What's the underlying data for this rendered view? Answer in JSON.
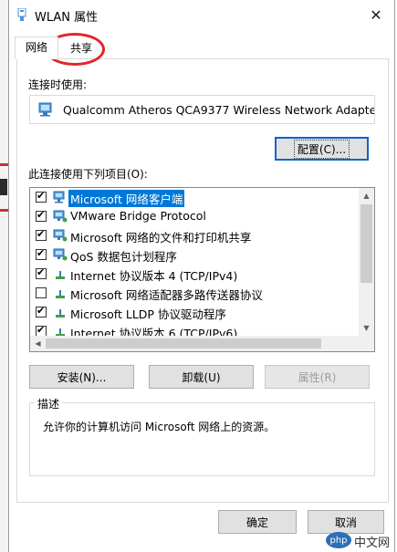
{
  "window": {
    "title": "WLAN 属性",
    "close_label": "✕"
  },
  "tabs": [
    {
      "label": "网络"
    },
    {
      "label": "共享"
    }
  ],
  "connect_using_label": "连接时使用:",
  "adapter_name": "Qualcomm Atheros QCA9377 Wireless Network Adapte",
  "configure_label": "配置(C)...",
  "items_label": "此连接使用下列项目(O):",
  "items": [
    {
      "label": "Microsoft 网络客户端",
      "checked": true,
      "icon": "network-client-icon"
    },
    {
      "label": "VMware Bridge Protocol",
      "checked": true,
      "icon": "network-service-icon"
    },
    {
      "label": "Microsoft 网络的文件和打印机共享",
      "checked": true,
      "icon": "network-service-icon"
    },
    {
      "label": "QoS 数据包计划程序",
      "checked": true,
      "icon": "network-service-icon"
    },
    {
      "label": "Internet 协议版本 4 (TCP/IPv4)",
      "checked": true,
      "icon": "protocol-icon"
    },
    {
      "label": "Microsoft 网络适配器多路传送器协议",
      "checked": false,
      "icon": "protocol-icon"
    },
    {
      "label": "Microsoft LLDP 协议驱动程序",
      "checked": true,
      "icon": "protocol-icon"
    },
    {
      "label": "Internet 协议版本 6 (TCP/IPv6)",
      "checked": true,
      "icon": "protocol-icon"
    }
  ],
  "buttons": {
    "install": "安装(N)...",
    "uninstall": "卸载(U)",
    "properties": "属性(R)",
    "ok": "确定",
    "cancel": "取消"
  },
  "description": {
    "title": "描述",
    "text": "允许你的计算机访问 Microsoft 网络上的资源。"
  },
  "watermark": {
    "badge": "php",
    "text": "中文网"
  },
  "colors": {
    "selection": "#0078d7",
    "focus_border": "#0a64c8",
    "annotation": "#e0262a"
  }
}
